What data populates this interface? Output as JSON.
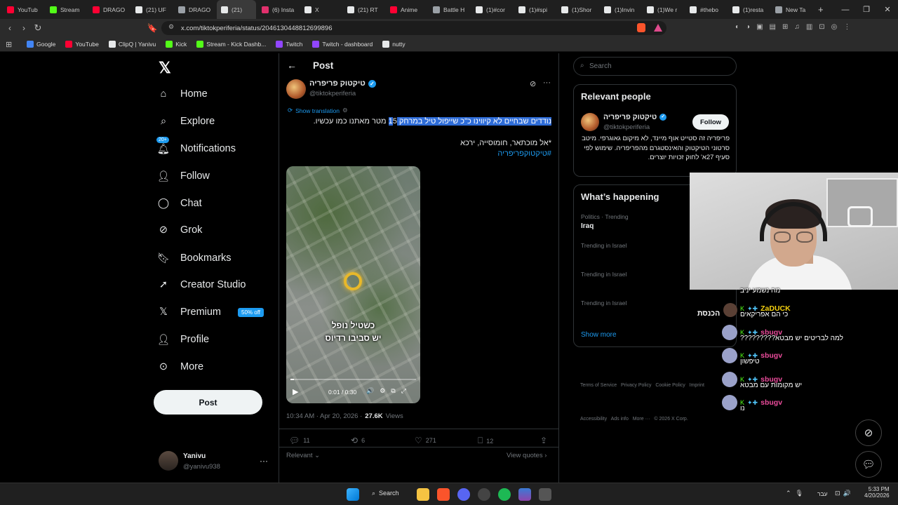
{
  "browser": {
    "tabs": [
      {
        "label": "YouTub",
        "color": "#ff0033"
      },
      {
        "label": "Stream",
        "color": "#53fc18"
      },
      {
        "label": "DRAGO",
        "color": "#ff0033"
      },
      {
        "label": "(21) UF",
        "color": "#e7e9ea"
      },
      {
        "label": "DRAGO",
        "color": "#9aa0a6"
      },
      {
        "label": "(21)",
        "color": "#e7e9ea",
        "active": true
      },
      {
        "label": "(6) Insta",
        "color": "#e1306c"
      },
      {
        "label": "X",
        "color": "#e7e9ea"
      },
      {
        "label": "(21) RT",
        "color": "#e7e9ea"
      },
      {
        "label": "Anime",
        "color": "#ff0033"
      },
      {
        "label": "Battle H",
        "color": "#9aa0a6"
      },
      {
        "label": "(1)#cor",
        "color": "#e7e9ea"
      },
      {
        "label": "(1)#spi",
        "color": "#e7e9ea"
      },
      {
        "label": "(1)Shor",
        "color": "#e7e9ea"
      },
      {
        "label": "(1)Invin",
        "color": "#e7e9ea"
      },
      {
        "label": "(1)We r",
        "color": "#e7e9ea"
      },
      {
        "label": "#thebo",
        "color": "#e7e9ea"
      },
      {
        "label": "(1)resta",
        "color": "#e7e9ea"
      },
      {
        "label": "New Ta",
        "color": "#9aa0a6"
      }
    ],
    "url": "x.com/tiktokperiferia/status/2046130448812699896",
    "bookmarks": [
      {
        "label": "Google",
        "color": "#4285f4"
      },
      {
        "label": "YouTube",
        "color": "#ff0033"
      },
      {
        "label": "ClipQ | Yanivu",
        "color": "#e7e9ea"
      },
      {
        "label": "Kick",
        "color": "#53fc18"
      },
      {
        "label": "Stream - Kick Dashb...",
        "color": "#53fc18"
      },
      {
        "label": "Twitch",
        "color": "#9146ff"
      },
      {
        "label": "Twitch - dashboard",
        "color": "#9146ff"
      },
      {
        "label": "nutty",
        "color": "#e7e9ea"
      }
    ]
  },
  "sidebar": {
    "items": [
      {
        "label": "Home",
        "icon": "home-icon"
      },
      {
        "label": "Explore",
        "icon": "search-icon"
      },
      {
        "label": "Notifications",
        "icon": "bell-icon",
        "badge": "20+"
      },
      {
        "label": "Follow",
        "icon": "follow-icon"
      },
      {
        "label": "Chat",
        "icon": "chat-icon"
      },
      {
        "label": "Grok",
        "icon": "grok-icon"
      },
      {
        "label": "Bookmarks",
        "icon": "bookmark-icon"
      },
      {
        "label": "Creator Studio",
        "icon": "rocket-icon"
      },
      {
        "label": "Premium",
        "icon": "x-logo-icon",
        "badge": "50% off"
      },
      {
        "label": "Profile",
        "icon": "person-icon"
      },
      {
        "label": "More",
        "icon": "more-icon"
      }
    ],
    "post_button": "Post",
    "account": {
      "name": "Yanivu",
      "handle": "@yanivu938"
    }
  },
  "post": {
    "header": "Post",
    "author_name": "טיקטוק פריפריה",
    "author_handle": "@tiktokperiferia",
    "show_translation": "Show translation",
    "text_line1_highlight": "נודדים שבחיים לא קיווינו כ\"כ שייפול טיל במרחק 1",
    "text_line1_rest": "5 מטר מאתנו כמו עכשיו.",
    "text_line2": "*אל מוכתאר, חומוסייה, ירכא",
    "hashtag": "#טיקטוקפריפריה",
    "video_caption_line1": "כשטיל נופל",
    "video_caption_line2": "יש סביבו רדיוס",
    "video_time": "0:01 / 0:30",
    "timestamp": "10:34 AM · Apr 20, 2026 ·",
    "views_count": "27.6K",
    "views_label": "Views",
    "replies": "11",
    "reposts": "6",
    "likes": "271",
    "bookmarks": "12",
    "relevant": "Relevant",
    "view_quotes": "View quotes"
  },
  "right": {
    "search_placeholder": "Search",
    "relevant_people_title": "Relevant people",
    "person_name": "טיקטוק פריפריה",
    "person_handle": "@tiktokperiferia",
    "follow_label": "Follow",
    "person_bio": "פריפריה זה סטייט אוף מיינד, לא מיקום גאוגרפי. מיטב סרטוני הטיקטוק והאינסטגרם מהפריפריה. שימוש לפי סעיף 27א' לחוק זכויות יוצרים.",
    "happening_title": "What’s happening",
    "trends": [
      {
        "context": "Politics · Trending",
        "topic": "Iraq"
      },
      {
        "context": "Trending in Israel",
        "topic": ""
      },
      {
        "context": "Trending in Israel",
        "topic": ""
      },
      {
        "context": "Trending in Israel",
        "topic": ""
      }
    ],
    "show_more": "Show more",
    "footer_line1": "Terms of Service   Privacy Policy   Cookie Policy   Imprint",
    "footer_line2": "Accessibility   Ads info   More ···   © 2026 X Corp."
  },
  "chat": {
    "messages": [
      {
        "user": "",
        "text": "מה נשמע יניב"
      },
      {
        "user": "ZaDUCK",
        "text": "כי הם אפריקאים",
        "name_color": "#f5d10f"
      },
      {
        "user": "sbugv",
        "text": "למה לבריטים יש מבטא?????????",
        "name_color": "#ec4c9c"
      },
      {
        "user": "sbugv",
        "text": "טיפשון",
        "name_color": "#ec4c9c"
      },
      {
        "user": "sbugv",
        "text": "יש מקומות עם מבטא",
        "name_color": "#ec4c9c"
      },
      {
        "user": "sbugv",
        "text": "נו",
        "name_color": "#ec4c9c"
      }
    ],
    "side_label": "הכנסת"
  },
  "taskbar": {
    "search_label": "Search",
    "language": "עבר",
    "time": "5:33 PM",
    "date": "4/20/2026"
  }
}
